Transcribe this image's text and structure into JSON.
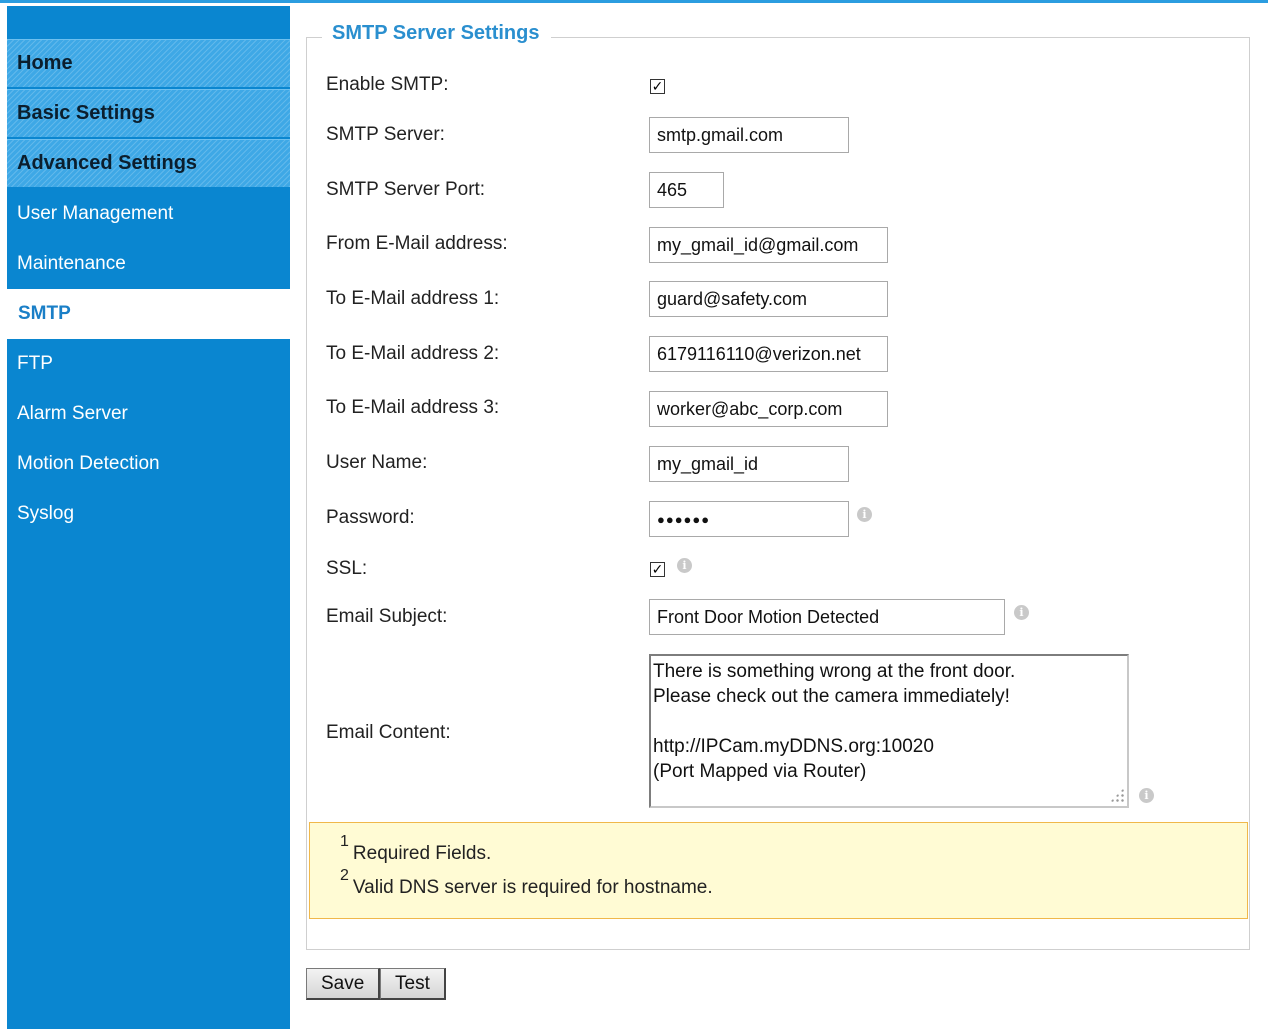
{
  "sidebar": {
    "headers": [
      "Home",
      "Basic Settings",
      "Advanced Settings"
    ],
    "items": [
      "User Management",
      "Maintenance",
      "SMTP",
      "FTP",
      "Alarm Server",
      "Motion Detection",
      "Syslog"
    ],
    "active": "SMTP"
  },
  "panel": {
    "legend": "SMTP Server Settings"
  },
  "form": {
    "enable_smtp": {
      "label": "Enable SMTP:",
      "checked": true
    },
    "smtp_server": {
      "label": "SMTP Server:",
      "value": "smtp.gmail.com"
    },
    "smtp_port": {
      "label": "SMTP Server Port:",
      "value": "465"
    },
    "from_email": {
      "label": "From E-Mail address:",
      "value": "my_gmail_id@gmail.com"
    },
    "to_email_1": {
      "label": "To E-Mail address 1:",
      "value": "guard@safety.com"
    },
    "to_email_2": {
      "label": "To E-Mail address 2:",
      "value": "6179116110@verizon.net"
    },
    "to_email_3": {
      "label": "To E-Mail address 3:",
      "value": "worker@abc_corp.com"
    },
    "user_name": {
      "label": "User Name:",
      "value": "my_gmail_id"
    },
    "password": {
      "label": "Password:",
      "value": "●●●●●●"
    },
    "ssl": {
      "label": "SSL:",
      "checked": true
    },
    "email_subject": {
      "label": "Email Subject:",
      "value": "Front Door Motion Detected"
    },
    "email_content": {
      "label": "Email Content:",
      "value": "There is something wrong at the front door.\nPlease check out the camera immediately!\n\nhttp://IPCam.myDDNS.org:10020\n(Port Mapped via Router)"
    }
  },
  "notes": [
    {
      "num": "1",
      "text": "Required Fields."
    },
    {
      "num": "2",
      "text": "Valid DNS server is required for hostname."
    }
  ],
  "buttons": {
    "save": "Save",
    "test": "Test"
  },
  "icons": {
    "info": "info-icon",
    "check": "checkmark"
  },
  "colors": {
    "sidebar": "#0a86d0",
    "accent": "#2a8fcf",
    "notes_bg": "#fffbd4"
  }
}
